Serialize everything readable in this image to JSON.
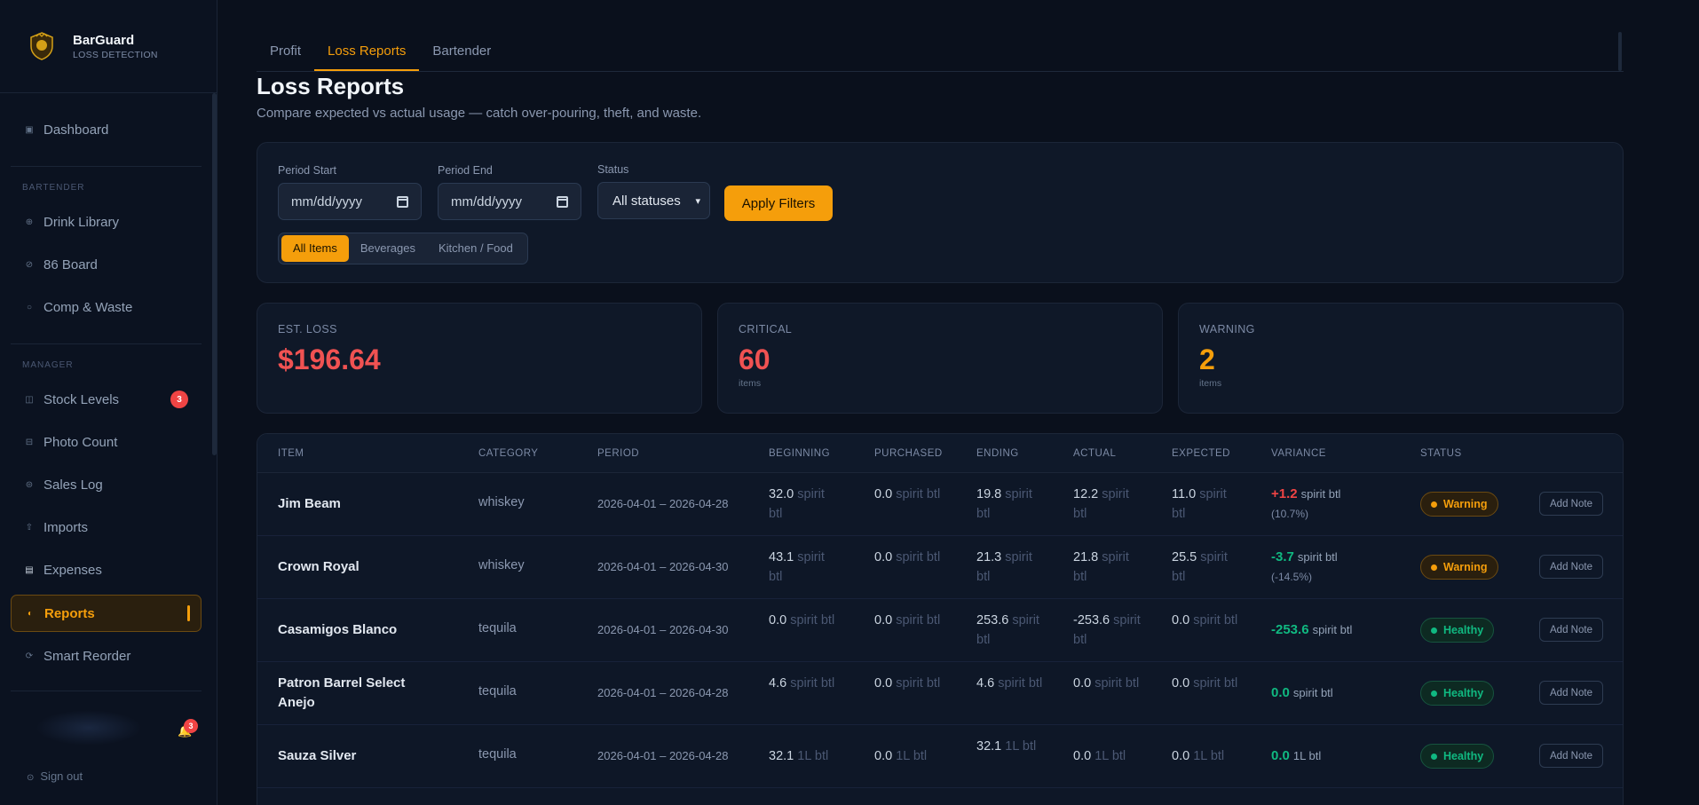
{
  "brand": {
    "name": "BarGuard",
    "subtitle": "LOSS DETECTION"
  },
  "sidebar": {
    "items": [
      {
        "label": "Dashboard",
        "icon": "grid-icon"
      },
      {
        "label": "Drink Library",
        "icon": "cocktail-icon"
      },
      {
        "label": "86 Board",
        "icon": "ban-icon"
      },
      {
        "label": "Comp & Waste",
        "icon": "recycle-icon"
      },
      {
        "label": "Stock Levels",
        "icon": "boxes-icon",
        "badge": "3"
      },
      {
        "label": "Photo Count",
        "icon": "camera-icon"
      },
      {
        "label": "Sales Log",
        "icon": "receipt-icon"
      },
      {
        "label": "Imports",
        "icon": "upload-icon"
      },
      {
        "label": "Expenses",
        "icon": "document-icon"
      },
      {
        "label": "Reports",
        "icon": "chart-icon"
      },
      {
        "label": "Smart Reorder",
        "icon": "refresh-icon"
      }
    ],
    "sections": {
      "bartender": "BARTENDER",
      "manager": "MANAGER"
    },
    "notification_badge": "3",
    "sign_out": "Sign out"
  },
  "tabs": [
    "Profit",
    "Loss Reports",
    "Bartender"
  ],
  "page": {
    "title": "Loss Reports",
    "description": "Compare expected vs actual usage — catch over-pouring, theft, and waste."
  },
  "filters": {
    "period_start_label": "Period Start",
    "period_start_value": "mm/dd/yyyy",
    "period_end_label": "Period End",
    "period_end_value": "mm/dd/yyyy",
    "status_label": "Status",
    "status_value": "All statuses",
    "apply_label": "Apply Filters",
    "segments": [
      "All Items",
      "Beverages",
      "Kitchen / Food"
    ]
  },
  "summary": {
    "est_loss": {
      "label": "EST. LOSS",
      "value": "$196.64",
      "color": "#f05252"
    },
    "critical": {
      "label": "CRITICAL",
      "value": "60",
      "sub": "items",
      "color": "#f05252"
    },
    "warning": {
      "label": "WARNING",
      "value": "2",
      "sub": "items",
      "color": "#f59e0b"
    }
  },
  "table": {
    "headers": [
      "ITEM",
      "CATEGORY",
      "PERIOD",
      "BEGINNING",
      "PURCHASED",
      "ENDING",
      "ACTUAL",
      "EXPECTED",
      "VARIANCE",
      "STATUS"
    ],
    "add_note_label": "Add Note",
    "rows": [
      {
        "item": "Jim Beam",
        "category": "whiskey",
        "period": "2026-04-01 – 2026-04-28",
        "beginning": "32.0",
        "beginning_unit": "spirit btl",
        "purchased": "0.0",
        "purchased_unit": "spirit btl",
        "ending": "19.8",
        "ending_unit": "spirit btl",
        "actual": "12.2",
        "actual_unit": "spirit btl",
        "expected": "11.0",
        "expected_unit": "spirit btl",
        "variance": "+1.2",
        "variance_unit": "spirit btl",
        "variance_pct": "(10.7%)",
        "status": "Warning"
      },
      {
        "item": "Crown Royal",
        "category": "whiskey",
        "period": "2026-04-01 – 2026-04-30",
        "beginning": "43.1",
        "beginning_unit": "spirit btl",
        "purchased": "0.0",
        "purchased_unit": "spirit btl",
        "ending": "21.3",
        "ending_unit": "spirit btl",
        "actual": "21.8",
        "actual_unit": "spirit btl",
        "expected": "25.5",
        "expected_unit": "spirit btl",
        "variance": "-3.7",
        "variance_unit": "spirit btl",
        "variance_pct": "(-14.5%)",
        "status": "Warning"
      },
      {
        "item": "Casamigos Blanco",
        "category": "tequila",
        "period": "2026-04-01 – 2026-04-30",
        "beginning": "0.0",
        "beginning_unit": "spirit btl",
        "purchased": "0.0",
        "purchased_unit": "spirit btl",
        "ending": "253.6",
        "ending_unit": "spirit btl",
        "actual": "-253.6",
        "actual_unit": "spirit btl",
        "expected": "0.0",
        "expected_unit": "spirit btl",
        "variance": "-253.6",
        "variance_unit": "spirit btl",
        "variance_pct": "",
        "status": "Healthy"
      },
      {
        "item": "Patron Barrel Select Anejo",
        "category": "tequila",
        "period": "2026-04-01 – 2026-04-28",
        "beginning": "4.6",
        "beginning_unit": "spirit btl",
        "purchased": "0.0",
        "purchased_unit": "spirit btl",
        "ending": "4.6",
        "ending_unit": "spirit btl",
        "actual": "0.0",
        "actual_unit": "spirit btl",
        "expected": "0.0",
        "expected_unit": "spirit btl",
        "variance": "0.0",
        "variance_unit": "spirit btl",
        "variance_pct": "",
        "status": "Healthy"
      },
      {
        "item": "Sauza Silver",
        "category": "tequila",
        "period": "2026-04-01 – 2026-04-28",
        "beginning": "32.1",
        "beginning_unit": "1L btl",
        "purchased": "0.0",
        "purchased_unit": "1L btl",
        "ending": "32.1",
        "ending_unit": "1L btl",
        "actual": "0.0",
        "actual_unit": "1L btl",
        "expected": "0.0",
        "expected_unit": "1L btl",
        "variance": "0.0",
        "variance_unit": "1L btl",
        "variance_pct": "",
        "status": "Healthy"
      }
    ]
  }
}
